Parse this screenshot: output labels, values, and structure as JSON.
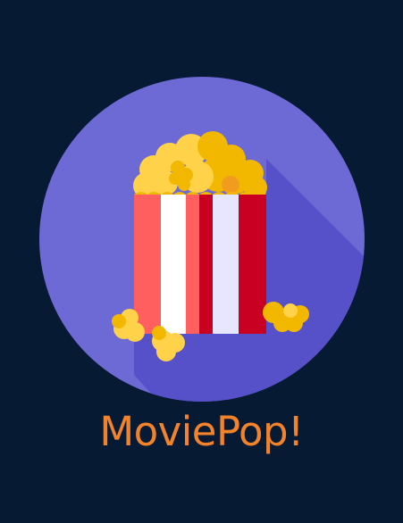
{
  "app": {
    "title": "MoviePop!",
    "logo_icon": "popcorn-bucket-icon"
  },
  "colors": {
    "background": "#071a33",
    "circle": "#6d6ad6",
    "shadow": "#5751c9",
    "title_text": "#f2832a",
    "stripe_red": "#ff5f5f",
    "stripe_darkred": "#c90021",
    "stripe_white": "#ffffff",
    "stripe_lavender": "#e6e6ff",
    "popcorn_light": "#ffd24a",
    "popcorn_dark": "#f2b800",
    "kernel": "#f29c1f"
  }
}
